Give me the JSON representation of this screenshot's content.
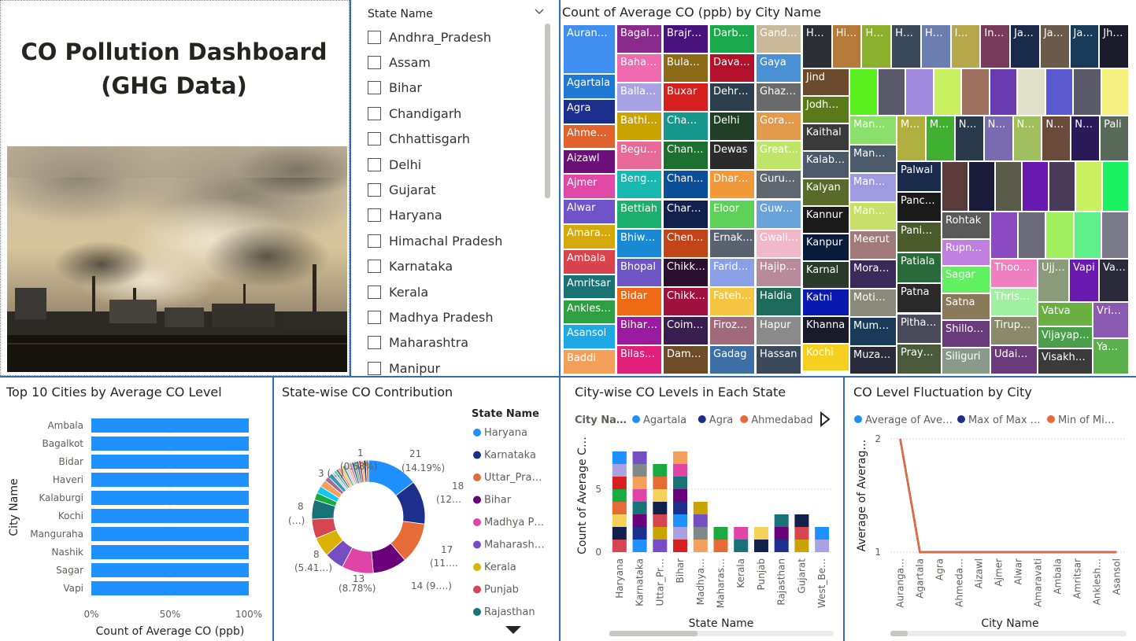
{
  "dashboard": {
    "title_line1": "CO Pollution Dashboard",
    "title_line2": "(GHG Data)"
  },
  "slicer": {
    "header": "State Name",
    "items": [
      "Andhra_Pradesh",
      "Assam",
      "Bihar",
      "Chandigarh",
      "Chhattisgarh",
      "Delhi",
      "Gujarat",
      "Haryana",
      "Himachal Pradesh",
      "Karnataka",
      "Kerala",
      "Madhya Pradesh",
      "Maharashtra",
      "Manipur"
    ]
  },
  "treemap": {
    "title": "Count of Average CO (ppb) by City Name",
    "cells": [
      {
        "label": "Auran…",
        "color": "#3f8ef0"
      },
      {
        "label": "Agartala",
        "color": "#1f78d1"
      },
      {
        "label": "Agra",
        "color": "#1c2f8c"
      },
      {
        "label": "Ahme…",
        "color": "#e0632c"
      },
      {
        "label": "Aizawl",
        "color": "#6b0f7a"
      },
      {
        "label": "Ajmer",
        "color": "#e04aa6"
      },
      {
        "label": "Alwar",
        "color": "#6f54c9"
      },
      {
        "label": "Amara…",
        "color": "#d4a90d"
      },
      {
        "label": "Ambala",
        "color": "#d9444c"
      },
      {
        "label": "Amritsar",
        "color": "#1a7373"
      },
      {
        "label": "Ankles…",
        "color": "#2ea043"
      },
      {
        "label": "Asansol",
        "color": "#1ea8e6"
      },
      {
        "label": "Baddi",
        "color": "#f5a05a"
      },
      {
        "label": "Bagal…",
        "color": "#8a2a8c"
      },
      {
        "label": "Baha…",
        "color": "#f06ab0"
      },
      {
        "label": "Balla…",
        "color": "#a9a3e6"
      },
      {
        "label": "Bathi…",
        "color": "#c9a300"
      },
      {
        "label": "Begu…",
        "color": "#e86a96"
      },
      {
        "label": "Beng…",
        "color": "#17b8b0"
      },
      {
        "label": "Bettiah",
        "color": "#1bb06d"
      },
      {
        "label": "Bhiw…",
        "color": "#1a8ad4"
      },
      {
        "label": "Bhopal",
        "color": "#6d55c4"
      },
      {
        "label": "Bidar",
        "color": "#ef6a14"
      },
      {
        "label": "Bihar…",
        "color": "#9c1aa0"
      },
      {
        "label": "Bilas…",
        "color": "#e0207a"
      },
      {
        "label": "Brajr…",
        "color": "#49137d"
      },
      {
        "label": "Bula…",
        "color": "#8c6a16"
      },
      {
        "label": "Buxar",
        "color": "#d61f1f"
      },
      {
        "label": "Cha…",
        "color": "#16998c"
      },
      {
        "label": "Chan…",
        "color": "#1e7031"
      },
      {
        "label": "Chan…",
        "color": "#0c4f99"
      },
      {
        "label": "Char…",
        "color": "#12204d"
      },
      {
        "label": "Chen…",
        "color": "#c2451a"
      },
      {
        "label": "Chikk…",
        "color": "#2a0f2e"
      },
      {
        "label": "Chikk…",
        "color": "#a11140"
      },
      {
        "label": "Coim…",
        "color": "#3a1e4f"
      },
      {
        "label": "Dam…",
        "color": "#6e4c2a"
      },
      {
        "label": "Darb…",
        "color": "#1ba84a"
      },
      {
        "label": "Dava…",
        "color": "#b3102a"
      },
      {
        "label": "Dehr…",
        "color": "#2c3d4c"
      },
      {
        "label": "Delhi",
        "color": "#1f4025"
      },
      {
        "label": "Dewas",
        "color": "#2b2b2b"
      },
      {
        "label": "Dhar…",
        "color": "#f29a3a"
      },
      {
        "label": "Eloor",
        "color": "#5ed158"
      },
      {
        "label": "Ernak…",
        "color": "#5a6270"
      },
      {
        "label": "Farid…",
        "color": "#8aa0e6"
      },
      {
        "label": "Fateh…",
        "color": "#f5c542"
      },
      {
        "label": "Firoz…",
        "color": "#a06a7a"
      },
      {
        "label": "Gadag",
        "color": "#3b6fa6"
      },
      {
        "label": "Gand…",
        "color": "#c9b89a"
      },
      {
        "label": "Gaya",
        "color": "#4a90d4"
      },
      {
        "label": "Ghaz…",
        "color": "#6a6a6a"
      },
      {
        "label": "Gora…",
        "color": "#e39a4a"
      },
      {
        "label": "Great…",
        "color": "#c0e36a"
      },
      {
        "label": "Guru…",
        "color": "#5f6770"
      },
      {
        "label": "Guw…",
        "color": "#6aa3d9"
      },
      {
        "label": "Gwali…",
        "color": "#f0b8c8"
      },
      {
        "label": "Hajip…",
        "color": "#b88a9a"
      },
      {
        "label": "Haldia",
        "color": "#1d6b5a"
      },
      {
        "label": "Hapur",
        "color": "#8a8a8a"
      },
      {
        "label": "Hassan",
        "color": "#3a4a5a"
      }
    ],
    "cells2": [
      {
        "label": "H…",
        "color": "#2b2f33"
      },
      {
        "label": "Hi…",
        "color": "#b87a3a"
      },
      {
        "label": "H…",
        "color": "#8ab02e"
      },
      {
        "label": "H…",
        "color": "#3a4a5a"
      },
      {
        "label": "H…",
        "color": "#6a7fb0"
      },
      {
        "label": "I…",
        "color": "#b8a64a"
      },
      {
        "label": "In…",
        "color": "#7a3a5a"
      },
      {
        "label": "Ja…",
        "color": "#1a2a4a"
      },
      {
        "label": "Ja…",
        "color": "#6a5a4a"
      },
      {
        "label": "Ja…",
        "color": "#1a3a5a"
      },
      {
        "label": "Jh…",
        "color": "#1a1a2a"
      },
      {
        "label": "Jind",
        "color": "#6a4a2a"
      },
      {
        "label": "Jodh…",
        "color": "#5a7a1a"
      },
      {
        "label": "Kaithal",
        "color": "#3a3a3a"
      },
      {
        "label": "Kalab…",
        "color": "#4a5a6a"
      },
      {
        "label": "Kalyan",
        "color": "#5a6a2a"
      },
      {
        "label": "Kannur",
        "color": "#1a1a1a"
      },
      {
        "label": "Kanpur",
        "color": "#0a1a3a"
      },
      {
        "label": "Karnal",
        "color": "#2a3a2a"
      },
      {
        "label": "Katni",
        "color": "#0a1ab0"
      },
      {
        "label": "Khanna",
        "color": "#1a1a2a"
      },
      {
        "label": "Kochi",
        "color": "#f5d020"
      },
      {
        "label": "",
        "color": "#5af020"
      },
      {
        "label": "",
        "color": "#5a5a6a"
      },
      {
        "label": "",
        "color": "#a08ae0"
      },
      {
        "label": "",
        "color": "#c8f060"
      },
      {
        "label": "",
        "color": "#a07060"
      },
      {
        "label": "",
        "color": "#6a3ab0"
      },
      {
        "label": "",
        "color": "#e0e0c8"
      },
      {
        "label": "",
        "color": "#5a5ad0"
      },
      {
        "label": "",
        "color": "#5a5a6a"
      },
      {
        "label": "",
        "color": "#f5f080"
      },
      {
        "label": "Man…",
        "color": "#8ae06a"
      },
      {
        "label": "Man…",
        "color": "#4a5a6a"
      },
      {
        "label": "Man…",
        "color": "#a09ae0"
      },
      {
        "label": "Man…",
        "color": "#c8e06a"
      },
      {
        "label": "Meerut",
        "color": "#a07a7a"
      },
      {
        "label": "Mora…",
        "color": "#3a2a5a"
      },
      {
        "label": "Moti…",
        "color": "#8a8a7a"
      },
      {
        "label": "Mum…",
        "color": "#1a3a5a"
      },
      {
        "label": "Muza…",
        "color": "#2a2a3a"
      },
      {
        "label": "M…",
        "color": "#b0b040"
      },
      {
        "label": "M…",
        "color": "#40b030"
      },
      {
        "label": "N…",
        "color": "#2a3a4a"
      },
      {
        "label": "N…",
        "color": "#7a6ab0"
      },
      {
        "label": "N…",
        "color": "#a0c060"
      },
      {
        "label": "N…",
        "color": "#6a4a3a"
      },
      {
        "label": "N…",
        "color": "#2a1a5a"
      },
      {
        "label": "Pali",
        "color": "#5a6a5a"
      },
      {
        "label": "Palwal",
        "color": "#1a2a4a"
      },
      {
        "label": "Panc…",
        "color": "#1a1a1a"
      },
      {
        "label": "Pani…",
        "color": "#4a5a2a"
      },
      {
        "label": "Patiala",
        "color": "#2a6a3a"
      },
      {
        "label": "Patna",
        "color": "#2a2a2a"
      },
      {
        "label": "Pitha…",
        "color": "#4a4a5a"
      },
      {
        "label": "Pray…",
        "color": "#4a5a3a"
      },
      {
        "label": "",
        "color": "#5a3a3a"
      },
      {
        "label": "",
        "color": "#1a1a3a"
      },
      {
        "label": "",
        "color": "#5a5a4a"
      },
      {
        "label": "",
        "color": "#6a1ab0"
      },
      {
        "label": "",
        "color": "#4a3a5a"
      },
      {
        "label": "",
        "color": "#c8f060"
      },
      {
        "label": "",
        "color": "#1af060"
      },
      {
        "label": "Rohtak",
        "color": "#5a5a5a"
      },
      {
        "label": "Rupn…",
        "color": "#c080e0"
      },
      {
        "label": "Sagar",
        "color": "#60f060"
      },
      {
        "label": "Satna",
        "color": "#8a7a5a"
      },
      {
        "label": "Shillo…",
        "color": "#6a3a7a"
      },
      {
        "label": "Siliguri",
        "color": "#8a9a8a"
      },
      {
        "label": "",
        "color": "#8a4ac0"
      },
      {
        "label": "",
        "color": "#6a6a7a"
      },
      {
        "label": "",
        "color": "#a0f060"
      },
      {
        "label": "",
        "color": "#60f08a"
      },
      {
        "label": "",
        "color": "#7a7a8a"
      },
      {
        "label": "Thoo…",
        "color": "#f080c0"
      },
      {
        "label": "Thris…",
        "color": "#a0f0a0"
      },
      {
        "label": "Tirup…",
        "color": "#8a8a6a"
      },
      {
        "label": "Udai…",
        "color": "#6a3a7a"
      },
      {
        "label": "Ujj…",
        "color": "#8a9a7a"
      },
      {
        "label": "Vapi",
        "color": "#6a1ab0"
      },
      {
        "label": "Va…",
        "color": "#2a2a3a"
      },
      {
        "label": "Vatva",
        "color": "#6ab040"
      },
      {
        "label": "Vijayap…",
        "color": "#4aa04a"
      },
      {
        "label": "Visakh…",
        "color": "#3a3a3a"
      },
      {
        "label": "Vri…",
        "color": "#8a5ab0"
      },
      {
        "label": "Ya…",
        "color": "#5ab04a"
      }
    ]
  },
  "chart_data": [
    {
      "type": "bar",
      "title": "Top 10 Cities by Average CO Level",
      "xlabel": "Count of Average CO (ppb)",
      "ylabel": "City Name",
      "categories": [
        "Ambala",
        "Bagalkot",
        "Bidar",
        "Haveri",
        "Kalaburgi",
        "Kochi",
        "Manguraha",
        "Nashik",
        "Sagar",
        "Vapi"
      ],
      "values": [
        100,
        100,
        100,
        100,
        100,
        100,
        100,
        100,
        100,
        100
      ],
      "xticks": [
        "0%",
        "50%",
        "100%"
      ],
      "xlim": [
        0,
        100
      ],
      "color": "#1e90ff"
    },
    {
      "type": "pie",
      "title": "State-wise CO Contribution",
      "legend_title": "State Name",
      "legend": [
        "Haryana",
        "Karnataka",
        "Uttar_Pra…",
        "Bihar",
        "Madhya P…",
        "Maharash…",
        "Kerala",
        "Punjab",
        "Rajasthan"
      ],
      "slices": [
        {
          "value": 21,
          "color": "#1e90ff"
        },
        {
          "value": 18,
          "color": "#1c2f8c"
        },
        {
          "value": 17,
          "color": "#e66c37"
        },
        {
          "value": 14,
          "color": "#6b007b"
        },
        {
          "value": 13,
          "color": "#e044a7"
        },
        {
          "value": 8,
          "color": "#744ec2"
        },
        {
          "value": 8,
          "color": "#d9b300"
        },
        {
          "value": 8,
          "color": "#d64550"
        },
        {
          "value": 8,
          "color": "#197278"
        },
        {
          "value": 3,
          "color": "#1aab40"
        },
        {
          "value": 3,
          "color": "#15c6f4"
        },
        {
          "value": 3,
          "color": "#f5a05a"
        },
        {
          "value": 2,
          "color": "#a66999"
        },
        {
          "value": 2,
          "color": "#3599b8"
        },
        {
          "value": 1,
          "color": "#dfbfbf"
        },
        {
          "value": 1,
          "color": "#4ac5bb"
        },
        {
          "value": 1,
          "color": "#5f6b6d"
        },
        {
          "value": 1,
          "color": "#fb8281"
        },
        {
          "value": 1,
          "color": "#f4d25a"
        },
        {
          "value": 1,
          "color": "#7f898a"
        },
        {
          "value": 1,
          "color": "#a4ddee"
        },
        {
          "value": 1,
          "color": "#fdab89"
        },
        {
          "value": 1,
          "color": "#b687ac"
        },
        {
          "value": 1,
          "color": "#28738a"
        },
        {
          "value": 1,
          "color": "#a78f8f"
        },
        {
          "value": 1,
          "color": "#168980"
        },
        {
          "value": 1,
          "color": "#e0207a"
        },
        {
          "value": 1,
          "color": "#f0c020"
        },
        {
          "value": 1,
          "color": "#1a3a8a"
        },
        {
          "value": 1,
          "color": "#e06a14"
        }
      ],
      "labels": [
        {
          "text1": "21",
          "text2": "(14.19%)"
        },
        {
          "text1": "18",
          "text2": "(12…"
        },
        {
          "text1": "17",
          "text2": "(11…."
        },
        {
          "text1": "14 (9….)",
          "text2": ""
        },
        {
          "text1": "13",
          "text2": "(8.78%)"
        },
        {
          "text1": "8",
          "text2": "(5.41…)"
        },
        {
          "text1": "8",
          "text2": "(…)"
        },
        {
          "text1": "3 (…)",
          "text2": ""
        },
        {
          "text1": "(0.68%)",
          "text2": ""
        },
        {
          "text1": "1",
          "text2": ""
        }
      ]
    },
    {
      "type": "bar",
      "stacked": true,
      "title": "City-wise CO Levels in Each State",
      "legend_title": "City Na…",
      "legend": [
        {
          "name": "Agartala",
          "color": "#1e90ff"
        },
        {
          "name": "Agra",
          "color": "#1c2f8c"
        },
        {
          "name": "Ahmedabad",
          "color": "#e66c37"
        }
      ],
      "xlabel": "State Name",
      "ylabel": "Count of Average C…",
      "categories": [
        "Haryana",
        "Karnataka",
        "Uttar_Pr…",
        "Bihar",
        "Madhya…",
        "Maharas…",
        "Kerala",
        "Punjab",
        "Rajasthan",
        "Gujarat",
        "West_Be…"
      ],
      "values": [
        8,
        8,
        7,
        8,
        4,
        2,
        2,
        2,
        3,
        3,
        2
      ],
      "yticks": [
        0,
        5
      ],
      "ylim": [
        0,
        9
      ],
      "segment_colors": [
        "#d64550",
        "#e044a7",
        "#a9a3e6",
        "#12204d",
        "#f5a05a",
        "#1e90ff",
        "#f4d25a",
        "#7f898a",
        "#1c2f8c",
        "#e66c37",
        "#744ec2",
        "#6b007b",
        "#1aab40",
        "#c9a300",
        "#197278",
        "#d61f1f"
      ]
    },
    {
      "type": "line",
      "title": "CO Level Fluctuation by City",
      "legend": [
        {
          "name": "Average of Ave…",
          "color": "#1e90ff"
        },
        {
          "name": "Max of Max …",
          "color": "#1c2f8c"
        },
        {
          "name": "Min of Mi…",
          "color": "#e66c37"
        }
      ],
      "xlabel": "City Name",
      "ylabel": "Average of Averag…",
      "x": [
        "Auranga…",
        "Agartala",
        "Agra",
        "Ahmeda…",
        "Aizawl",
        "Ajmer",
        "Alwar",
        "Amaravati",
        "Ambala",
        "Amritsar",
        "Anklesh…",
        "Asansol"
      ],
      "series": [
        {
          "name": "Average of Ave…",
          "values": [
            2,
            1,
            1,
            1,
            1,
            1,
            1,
            1,
            1,
            1,
            1,
            1
          ]
        },
        {
          "name": "Max of Max …",
          "values": [
            2,
            1,
            1,
            1,
            1,
            1,
            1,
            1,
            1,
            1,
            1,
            1
          ]
        },
        {
          "name": "Min of Mi…",
          "values": [
            2,
            1,
            1,
            1,
            1,
            1,
            1,
            1,
            1,
            1,
            1,
            1
          ]
        }
      ],
      "yticks": [
        1,
        2
      ],
      "ylim": [
        1,
        2
      ]
    }
  ]
}
